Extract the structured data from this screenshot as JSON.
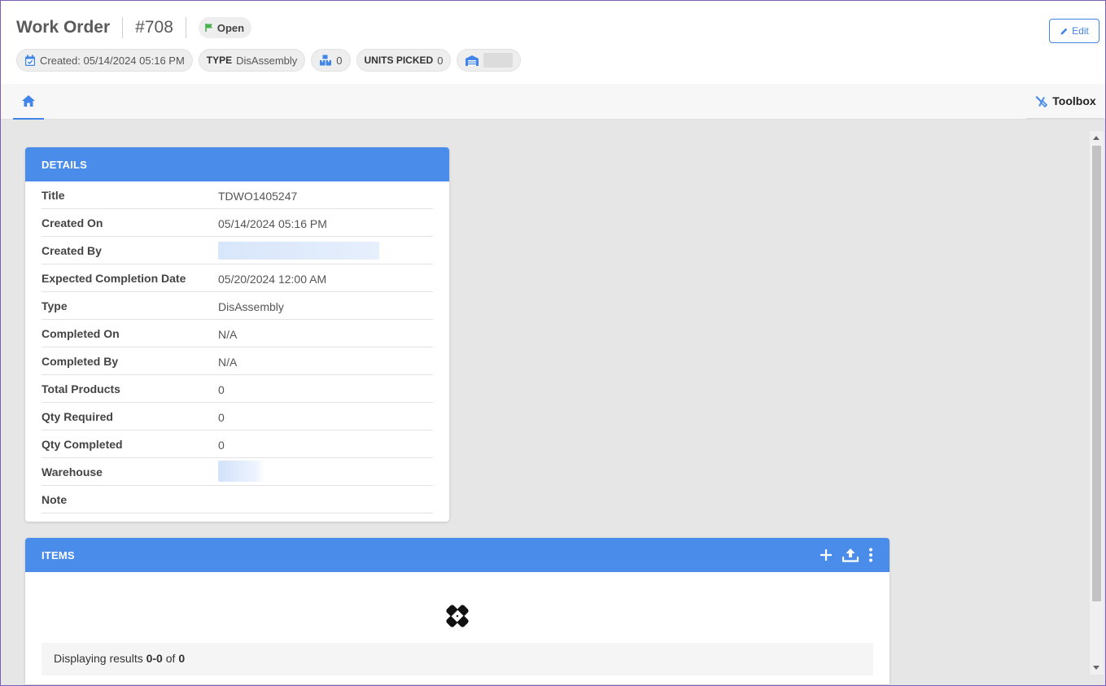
{
  "header": {
    "title": "Work Order",
    "order_number": "#708",
    "status": "Open",
    "edit_label": "Edit"
  },
  "chips": {
    "created": "Created: 05/14/2024 05:16 PM",
    "type_label": "TYPE",
    "type_value": "DisAssembly",
    "boxes_count": "0",
    "units_picked_label": "UNITS PICKED",
    "units_picked_value": "0"
  },
  "tabs": {
    "toolbox_label": "Toolbox"
  },
  "details": {
    "heading": "DETAILS",
    "rows": [
      {
        "label": "Title",
        "value": "TDWO1405247"
      },
      {
        "label": "Created On",
        "value": "05/14/2024 05:16 PM"
      },
      {
        "label": "Created By",
        "value": ""
      },
      {
        "label": "Expected Completion Date",
        "value": "05/20/2024 12:00 AM"
      },
      {
        "label": "Type",
        "value": "DisAssembly"
      },
      {
        "label": "Completed On",
        "value": "N/A"
      },
      {
        "label": "Completed By",
        "value": "N/A"
      },
      {
        "label": "Total Products",
        "value": "0"
      },
      {
        "label": "Qty Required",
        "value": "0"
      },
      {
        "label": "Qty Completed",
        "value": "0"
      },
      {
        "label": "Warehouse",
        "value": ""
      },
      {
        "label": "Note",
        "value": ""
      }
    ]
  },
  "items": {
    "heading": "ITEMS",
    "results_prefix": "Displaying results",
    "results_range": "0-0",
    "results_of": "of",
    "results_total": "0"
  },
  "colors": {
    "accent": "#4285e8",
    "card_header": "#4a8ce9",
    "status_flag": "#4caf50"
  }
}
